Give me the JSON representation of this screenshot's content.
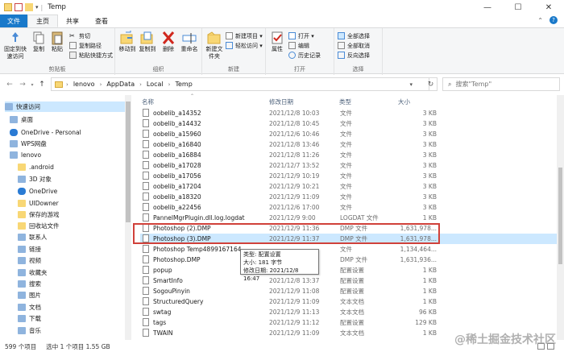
{
  "window": {
    "title": "Temp",
    "ctrls": [
      "—",
      "☐",
      "✕"
    ]
  },
  "tabs": [
    "文件",
    "主页",
    "共享",
    "查看"
  ],
  "ribbon": {
    "clipboard": {
      "label": "剪贴板",
      "pin": "固定到快速访问",
      "copy": "复制",
      "paste": "粘贴",
      "cut": "剪切",
      "copy_path": "复制路径",
      "paste_shortcut": "粘贴快捷方式"
    },
    "organize": {
      "label": "组织",
      "move_to": "移动到",
      "copy_to": "复制到",
      "delete": "删除",
      "rename": "重命名"
    },
    "new": {
      "label": "新建",
      "new_folder": "新建文件夹",
      "new_item": "新建项目 ▾",
      "easy_access": "轻松访问 ▾"
    },
    "open": {
      "label": "打开",
      "properties": "属性",
      "open": "打开 ▾",
      "edit": "编辑",
      "history": "历史记录"
    },
    "select": {
      "label": "选择",
      "select_all": "全部选择",
      "select_none": "全部取消",
      "invert": "反向选择"
    }
  },
  "address": {
    "segments": [
      "lenovo",
      "AppData",
      "Local",
      "Temp"
    ],
    "search_placeholder": "搜索\"Temp\""
  },
  "nav": [
    {
      "label": "快速访问",
      "icon": "star-icon",
      "sel": true
    },
    {
      "label": "桌面",
      "icon": "desktop-icon"
    },
    {
      "label": "OneDrive - Personal",
      "icon": "cloud-icon"
    },
    {
      "label": "WPS网盘",
      "icon": "cloud-drive-icon"
    },
    {
      "label": "lenovo",
      "icon": "user-icon"
    },
    {
      "label": ".android",
      "icon": "folder-icon"
    },
    {
      "label": "3D 对象",
      "icon": "cube-icon"
    },
    {
      "label": "OneDrive",
      "icon": "cloud-icon"
    },
    {
      "label": "UIDowner",
      "icon": "folder-icon"
    },
    {
      "label": "保存的游戏",
      "icon": "folder-icon"
    },
    {
      "label": "回收站文件",
      "icon": "folder-icon"
    },
    {
      "label": "联系人",
      "icon": "contacts-icon"
    },
    {
      "label": "链接",
      "icon": "link-icon"
    },
    {
      "label": "视频",
      "icon": "video-icon"
    },
    {
      "label": "收藏夹",
      "icon": "favorites-icon"
    },
    {
      "label": "搜索",
      "icon": "search-icon"
    },
    {
      "label": "图片",
      "icon": "picture-icon"
    },
    {
      "label": "文档",
      "icon": "document-icon"
    },
    {
      "label": "下载",
      "icon": "download-icon"
    },
    {
      "label": "音乐",
      "icon": "music-icon"
    }
  ],
  "columns": {
    "name": "名称",
    "date": "修改日期",
    "type": "类型",
    "size": "大小"
  },
  "files": [
    {
      "name": "oobelib_a14352",
      "date": "2021/12/8 10:03",
      "type": "文件",
      "size": "3 KB"
    },
    {
      "name": "oobelib_a14432",
      "date": "2021/12/8 10:45",
      "type": "文件",
      "size": "3 KB"
    },
    {
      "name": "oobelib_a15960",
      "date": "2021/12/6 10:46",
      "type": "文件",
      "size": "3 KB"
    },
    {
      "name": "oobelib_a16840",
      "date": "2021/12/8 13:46",
      "type": "文件",
      "size": "3 KB"
    },
    {
      "name": "oobelib_a16884",
      "date": "2021/12/8 11:26",
      "type": "文件",
      "size": "3 KB"
    },
    {
      "name": "oobelib_a17028",
      "date": "2021/12/7 13:52",
      "type": "文件",
      "size": "3 KB"
    },
    {
      "name": "oobelib_a17056",
      "date": "2021/12/9 10:19",
      "type": "文件",
      "size": "3 KB"
    },
    {
      "name": "oobelib_a17204",
      "date": "2021/12/9 10:21",
      "type": "文件",
      "size": "3 KB"
    },
    {
      "name": "oobelib_a18320",
      "date": "2021/12/9 11:09",
      "type": "文件",
      "size": "3 KB"
    },
    {
      "name": "oobelib_a22456",
      "date": "2021/12/6 17:00",
      "type": "文件",
      "size": "3 KB"
    },
    {
      "name": "PannelMgrPlugin.dll.log.logdat",
      "date": "2021/12/9 9:00",
      "type": "LOGDAT 文件",
      "size": "1 KB"
    },
    {
      "name": "Photoshop (2).DMP",
      "date": "2021/12/9 11:36",
      "type": "DMP 文件",
      "size": "1,631,978..."
    },
    {
      "name": "Photoshop (3).DMP",
      "date": "2021/12/9 11:37",
      "type": "DMP 文件",
      "size": "1,631,978...",
      "sel": true
    },
    {
      "name": "Photoshop Temp4899167164",
      "date": "",
      "type": "文件",
      "size": "1,134,464..."
    },
    {
      "name": "Photoshop.DMP",
      "date": "",
      "type": "DMP 文件",
      "size": "1,631,936..."
    },
    {
      "name": "popup",
      "date": "",
      "type": "配置设置",
      "size": "1 KB"
    },
    {
      "name": "SmartInfo",
      "date": "2021/12/8 13:37",
      "type": "配置设置",
      "size": "1 KB"
    },
    {
      "name": "SogouPinyin",
      "date": "2021/12/9 11:08",
      "type": "配置设置",
      "size": "1 KB"
    },
    {
      "name": "StructuredQuery",
      "date": "2021/12/9 11:09",
      "type": "文本文档",
      "size": "1 KB"
    },
    {
      "name": "swtag",
      "date": "2021/12/9 11:13",
      "type": "文本文档",
      "size": "96 KB"
    },
    {
      "name": "tags",
      "date": "2021/12/9 11:12",
      "type": "配置设置",
      "size": "129 KB"
    },
    {
      "name": "TWAIN",
      "date": "2021/12/9 11:09",
      "type": "文本文档",
      "size": "1 KB"
    }
  ],
  "tooltip": {
    "l1": "类型: 配置设置",
    "l2": "大小: 181 字节",
    "l3": "修改日期: 2021/12/8 16:47"
  },
  "status": {
    "count": "599 个项目",
    "selected": "选中 1 个项目 1.55 GB"
  },
  "watermark": "@稀土掘金技术社区"
}
